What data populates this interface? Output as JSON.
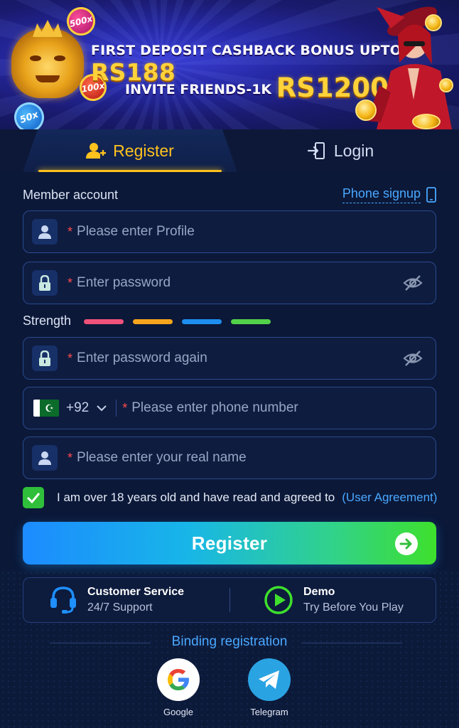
{
  "banner": {
    "line1_text": "FIRST DEPOSIT CASHBACK BONUS UPTO",
    "line1_amount": "RS188",
    "line2_text": "INVITE FRIENDS-1K",
    "line2_amount": "RS1200",
    "chips": [
      "500x",
      "100x",
      "50x"
    ]
  },
  "tabs": [
    {
      "label": "Register",
      "icon": "add-user-icon",
      "active": true
    },
    {
      "label": "Login",
      "icon": "login-icon",
      "active": false
    }
  ],
  "form": {
    "member_account_label": "Member account",
    "phone_signup_label": "Phone signup",
    "required_mark": "*",
    "profile_placeholder": "Please enter Profile",
    "password_placeholder": "Enter password",
    "strength_label": "Strength",
    "strength_colors": [
      "#f0517a",
      "#f7a51c",
      "#1e8ef0",
      "#52d149"
    ],
    "password_again_placeholder": "Enter password again",
    "country_code": "+92",
    "phone_placeholder": "Please enter phone number",
    "real_name_placeholder": "Please enter your real name",
    "agree_text": "I am over 18 years old and have read and agreed to",
    "agree_link": "(User Agreement)",
    "agree_checked": true,
    "register_button": "Register"
  },
  "support": {
    "service_title": "Customer Service",
    "service_subtitle": "24/7 Support",
    "demo_title": "Demo",
    "demo_subtitle": "Try Before You Play"
  },
  "binding": {
    "title": "Binding registration",
    "providers": [
      {
        "name": "Google",
        "icon": "google-icon"
      },
      {
        "name": "Telegram",
        "icon": "telegram-icon"
      }
    ]
  },
  "colors": {
    "accent_yellow": "#ffc21e",
    "link_blue": "#4aa8ff",
    "required_red": "#ff4a4a",
    "check_green": "#2fbf3a"
  }
}
